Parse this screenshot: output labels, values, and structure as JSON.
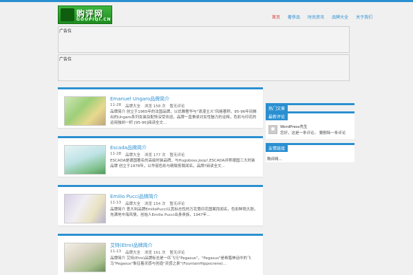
{
  "colors": {
    "accent": "#2a8fd0",
    "active_nav": "#dd3333",
    "logo_green": "#1f8c1f"
  },
  "logo": {
    "text_cn": "购评网",
    "text_en": "GOUPIQI.CN"
  },
  "nav": [
    {
      "label": "首页"
    },
    {
      "label": "奢侈品"
    },
    {
      "label": "时尚资讯"
    },
    {
      "label": "品牌大全"
    },
    {
      "label": "关于我们"
    }
  ],
  "ads": [
    {
      "label": "广告位"
    },
    {
      "label": "广告位"
    }
  ],
  "posts": [
    {
      "title": "Emanuel Ungaro品牌简介",
      "date": "11-28",
      "category": "品牌大全",
      "views": "浏览 158 次",
      "comments": "暂无评论",
      "excerpt": "品牌简介 创立于1965年的法国品牌，以优雅奢华与\"浪漫主义\"风格著称，95-96年间推出的Ungaro系列女装及配饰深受欢迎，品牌一直秉承对女性魅力的诠释，色彩与印花的运用独树一帜 [95-96]阅读全文..."
    },
    {
      "title": "Escada品牌简介",
      "date": "11-28",
      "category": "品牌大全",
      "views": "浏览 177 次",
      "comments": "暂无评论",
      "excerpt": "ESCADA是德国著名的高级时装品牌，与Hugoboss,Joop!,ESCADA并称德国三大时装品牌 创立于1978年，以华丽色彩与精致剪裁闻名，品牌?阅读全文..."
    },
    {
      "title": "Emilio Pucci品牌简介",
      "date": "11-13",
      "category": "品牌大全",
      "views": "浏览 154 次",
      "comments": "暂无评论",
      "excerpt": "品牌简介 意大利品牌EmilioPucci以其标志性的万花筒印花图案而闻名，色彩鲜艳大胆，充满地中海风情，创始人Emilio Pucci出身贵族，1947年..."
    },
    {
      "title": "艾特(Etro)品牌简介",
      "date": "11-13",
      "category": "品牌大全",
      "views": "浏览 161 次",
      "comments": "暂无评论",
      "excerpt": "品牌简介 艾特(Etro)品牌标志是一匹飞马\"Pegasus\"，\"Pegasus\"是希腊神话中的飞马\"Pegasus\"象征着灵感与创造\"灵感之泉\"(FountainHippocrene)..."
    }
  ],
  "widgets": {
    "w1": {
      "title": "热门文章"
    },
    "w2": {
      "title": "最新评论",
      "author": "WordPress先生",
      "text": "您好，这是一条评论。 要删除一条评论"
    },
    "w3": {
      "title": "友情链接",
      "item": "购评网..."
    }
  }
}
